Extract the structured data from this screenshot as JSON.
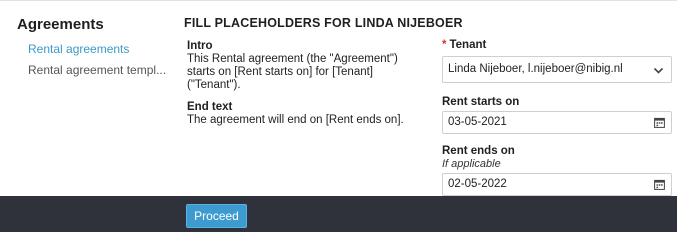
{
  "sidebar": {
    "title": "Agreements",
    "items": [
      {
        "label": "Rental agreements"
      },
      {
        "label": "Rental agreement templ..."
      }
    ]
  },
  "main": {
    "heading": "FILL PLACEHOLDERS FOR LINDA NIJEBOER",
    "intro": {
      "label": "Intro",
      "text": "This Rental agreement (the \"Agreement\") starts on [Rent starts on] for [Tenant] (\"Tenant\")."
    },
    "end_text": {
      "label": "End text",
      "text": "The agreement will end on [Rent ends on]."
    }
  },
  "form": {
    "tenant": {
      "required_mark": "*",
      "label": "Tenant",
      "value": "Linda Nijeboer, l.nijeboer@nibig.nl"
    },
    "rent_starts_on": {
      "label": "Rent starts on",
      "value": "03-05-2021"
    },
    "rent_ends_on": {
      "label": "Rent ends on",
      "hint": "If applicable",
      "value": "02-05-2022"
    }
  },
  "footer": {
    "proceed_label": "Proceed"
  },
  "colors": {
    "accent": "#3a9ac8",
    "button": "#3e9bd0",
    "footer_bg": "#2f323a",
    "required": "#d9342b"
  }
}
